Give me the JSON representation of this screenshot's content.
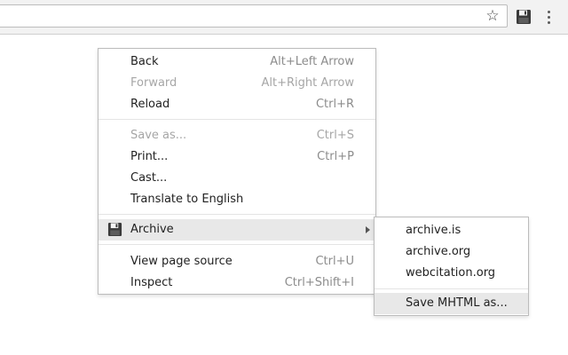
{
  "toolbar": {
    "bookmark_icon": "star-outline-icon",
    "extension_icon": "floppy-disk-icon",
    "menu_icon": "kebab-menu-icon"
  },
  "context_menu": {
    "items": [
      {
        "label": "Back",
        "shortcut": "Alt+Left Arrow",
        "enabled": true
      },
      {
        "label": "Forward",
        "shortcut": "Alt+Right Arrow",
        "enabled": false
      },
      {
        "label": "Reload",
        "shortcut": "Ctrl+R",
        "enabled": true
      },
      {
        "label": "Save as...",
        "shortcut": "Ctrl+S",
        "enabled": false
      },
      {
        "label": "Print...",
        "shortcut": "Ctrl+P",
        "enabled": true
      },
      {
        "label": "Cast...",
        "shortcut": "",
        "enabled": true
      },
      {
        "label": "Translate to English",
        "shortcut": "",
        "enabled": true
      },
      {
        "label": "Archive",
        "shortcut": "",
        "enabled": true,
        "icon": "floppy-disk-icon",
        "has_submenu": true,
        "highlighted": true
      },
      {
        "label": "View page source",
        "shortcut": "Ctrl+U",
        "enabled": true
      },
      {
        "label": "Inspect",
        "shortcut": "Ctrl+Shift+I",
        "enabled": true
      }
    ]
  },
  "archive_submenu": {
    "items": [
      {
        "label": "archive.is"
      },
      {
        "label": "archive.org"
      },
      {
        "label": "webcitation.org"
      },
      {
        "label": "Save MHTML as...",
        "highlighted": true
      }
    ]
  }
}
